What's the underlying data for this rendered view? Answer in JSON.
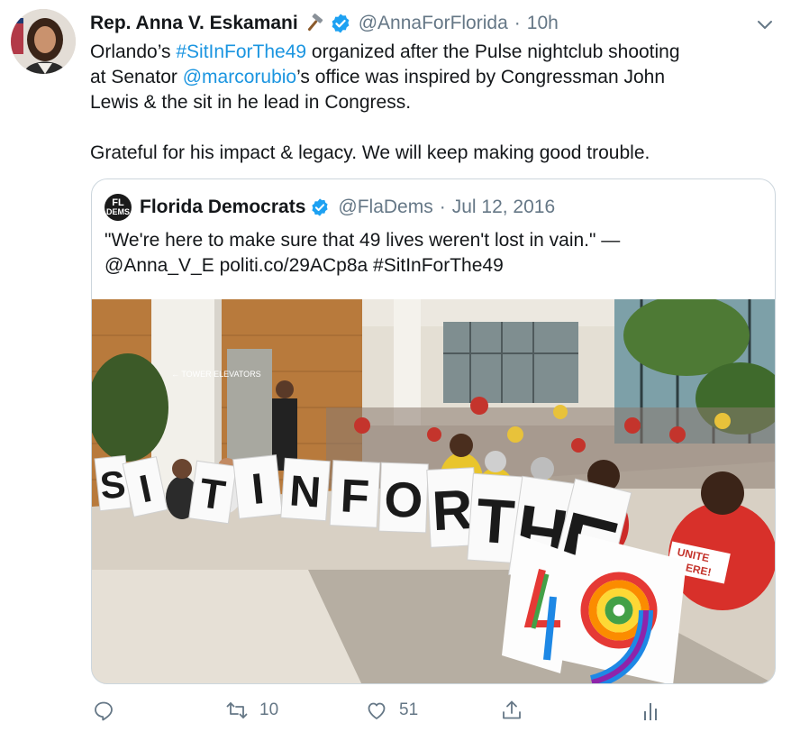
{
  "tweet": {
    "author_name": "Rep. Anna V. Eskamani",
    "author_handle": "@AnnaForFlorida",
    "separator": "·",
    "time": "10h",
    "body": {
      "line1_a": "Orlando’s ",
      "line1_hashtag": "#SitInForThe49",
      "line1_b": " organized after the Pulse nightclub shooting",
      "line2_a": "at Senator ",
      "line2_mention": "@marcorubio",
      "line2_b": "’s office was inspired by Congressman John",
      "line3": "Lewis & the sit in he lead in Congress.",
      "line5": "Grateful for his impact & legacy. We will keep making good trouble."
    }
  },
  "quoted_tweet": {
    "author_name": "Florida Democrats",
    "author_handle": "@FlaDems",
    "separator": "·",
    "time": "Jul 12, 2016",
    "avatar_top": "FL",
    "avatar_bottom": "DEMS",
    "text_line1": "\"We're here to make sure that 49 lives weren't lost in vain.\" —",
    "text_line2": "@Anna_V_E politi.co/29ACp8a #SitInForThe49"
  },
  "photo": {
    "sign_letters": [
      "S",
      "I",
      "T",
      "I",
      "N",
      "F",
      "O",
      "R",
      "T",
      "H",
      "E",
      "4",
      "9"
    ],
    "shirt_text_1": "UNITE",
    "shirt_text_2": "HERE!",
    "wall_sign": "← TOWER ELEVATORS"
  },
  "actions": {
    "reply_icon": "reply-icon",
    "retweet_icon": "retweet-icon",
    "retweet_count": "10",
    "like_icon": "heart-icon",
    "like_count": "51",
    "share_icon": "share-icon",
    "analytics_icon": "analytics-icon"
  },
  "colors": {
    "link": "#1b95e0",
    "verified": "#1da1f2",
    "secondary_text": "#657786",
    "border": "#ccd6dd"
  }
}
